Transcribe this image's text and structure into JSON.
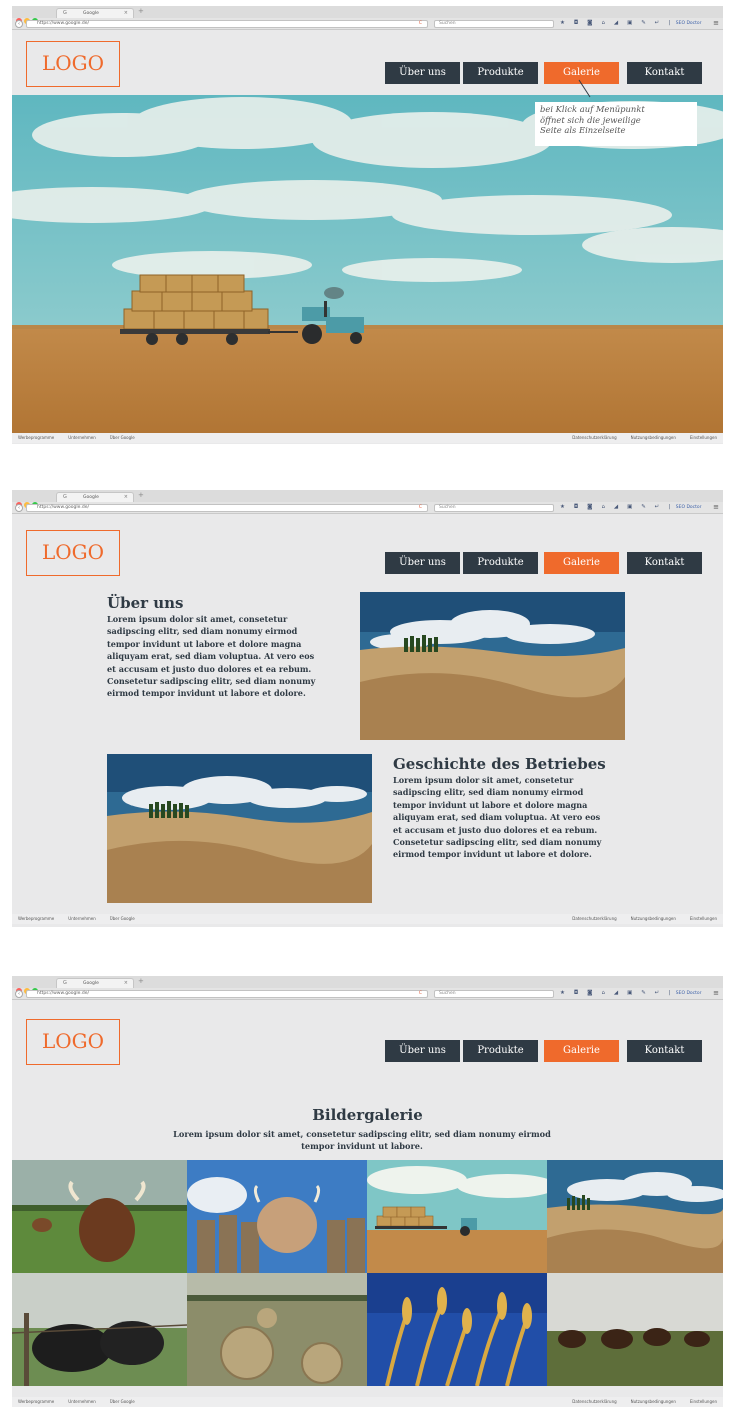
{
  "browser": {
    "tab_title": "Google",
    "url": "https://www.google.de/",
    "search_placeholder": "Suchen",
    "extension_label": "SEO Doctor",
    "reload_glyph": "C",
    "close_glyph": "×",
    "newtab_glyph": "+",
    "menu_glyph": "≡",
    "back_glyph": "‹",
    "toolbar_glyphs": "★ ◘ ◙ ⌂ ◢ ▣ ✎ ↵ |"
  },
  "logo": {
    "text": "LOGO"
  },
  "nav": {
    "items": [
      {
        "label": "Über uns"
      },
      {
        "label": "Produkte"
      },
      {
        "label": "Galerie"
      },
      {
        "label": "Kontakt"
      }
    ],
    "active_index": 2
  },
  "callout": {
    "line1": "bei Klick auf Menüpunkt",
    "line2": "öffnet sich die jeweilige",
    "line3": "Seite als Einzelseite"
  },
  "footer": {
    "left": [
      "Werbeprogramme",
      "Unternehmen",
      "Über Google"
    ],
    "right": [
      "Datenschutzerklärung",
      "Nutzungsbedingungen",
      "Einstellungen"
    ]
  },
  "about": {
    "title": "Über uns",
    "lines": [
      "Lorem ipsum dolor sit amet, consetetur",
      "sadipscing elitr, sed diam nonumy eirmod",
      "tempor invidunt ut labore et dolore magna",
      "aliquyam erat, sed diam voluptua. At vero eos",
      "et accusam et justo duo dolores et ea rebum.",
      "Consetetur sadipscing elitr, sed diam nonumy",
      "eirmod tempor invidunt ut labore et dolore."
    ]
  },
  "history": {
    "title": "Geschichte des Betriebes",
    "lines": [
      "Lorem ipsum dolor sit amet, consetetur",
      "sadipscing elitr, sed diam nonumy eirmod",
      "tempor invidunt ut labore et dolore magna",
      "aliquyam erat, sed diam voluptua. At vero eos",
      "et accusam et justo duo dolores et ea rebum.",
      "Consetetur sadipscing elitr, sed diam nonumy",
      "eirmod tempor invidunt ut labore et dolore."
    ]
  },
  "gallery": {
    "title": "Bildergalerie",
    "line1": "Lorem ipsum dolor sit amet, consetetur sadipscing elitr, sed diam nonumy eirmod",
    "line2": "tempor invidunt ut labore."
  },
  "colors": {
    "accent": "#ef6a2c",
    "nav_dark": "#2f3a44",
    "page_bg": "#e9e9ea"
  }
}
